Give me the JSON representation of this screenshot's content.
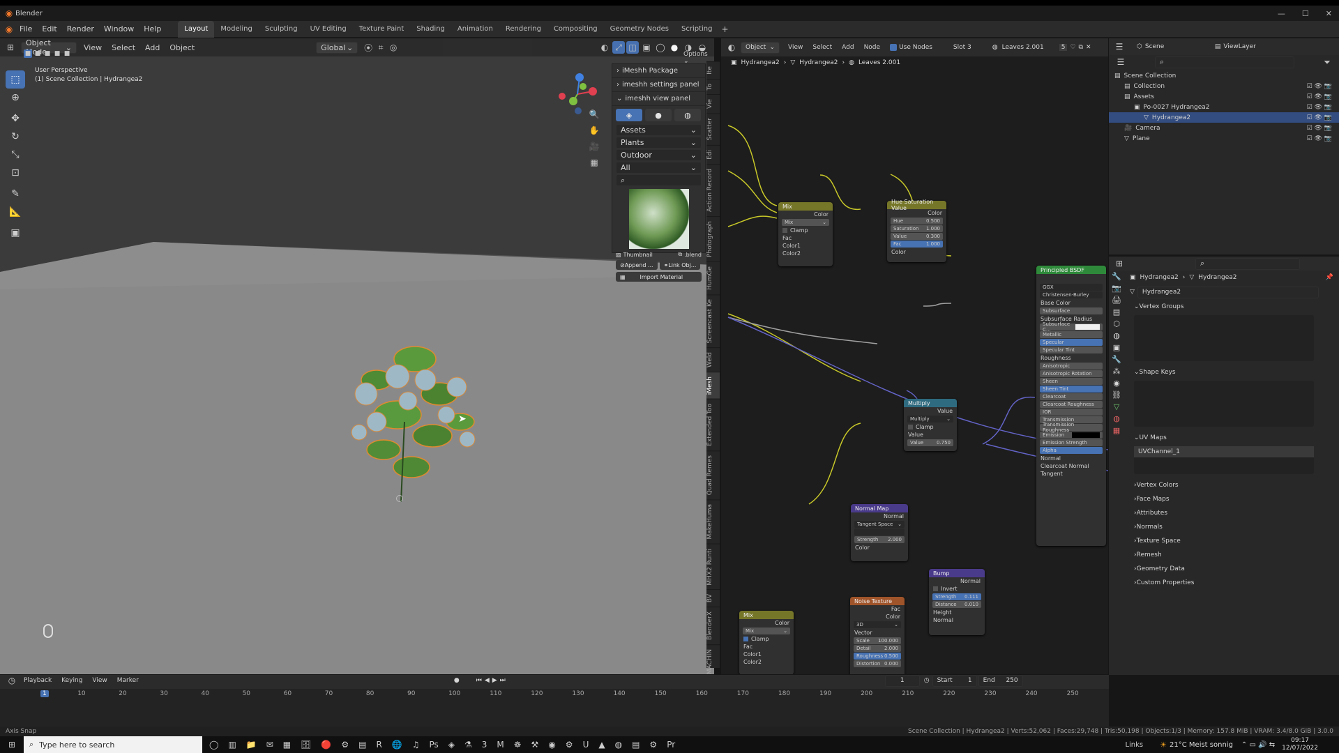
{
  "window": {
    "title": "Blender"
  },
  "menu": [
    "File",
    "Edit",
    "Render",
    "Window",
    "Help"
  ],
  "workspaces": [
    "Layout",
    "Modeling",
    "Sculpting",
    "UV Editing",
    "Texture Paint",
    "Shading",
    "Animation",
    "Rendering",
    "Compositing",
    "Geometry Nodes",
    "Scripting"
  ],
  "viewport": {
    "mode": "Object Mode",
    "menu": [
      "View",
      "Select",
      "Add",
      "Object"
    ],
    "transform": "Global",
    "options": "Options",
    "overlay_title": "User Perspective",
    "overlay_sub": "(1) Scene Collection | Hydrangea2"
  },
  "npanel": {
    "sections": [
      "iMeshh Package",
      "imeshh settings panel",
      "imeshh view panel"
    ],
    "dropdowns": [
      "Assets",
      "Plants",
      "Outdoor",
      "All"
    ],
    "thumbnail": "Thumbnail",
    "blend": ".blend",
    "append": "Append ...",
    "link": "Link Obj...",
    "import": "Import Material"
  },
  "side_tabs": [
    "Ite",
    "To",
    "Vie",
    "Scatter",
    "Edi",
    "Action Record",
    "Photograph",
    "HumGe",
    "Screencast Ke",
    "Weld",
    "iMesh",
    "Extended Too",
    "Quad Remes",
    "MakeHuma",
    "MHX2 Runti",
    "BV",
    "BlenderX",
    "MACHIN"
  ],
  "node_editor": {
    "header": {
      "object": "Object",
      "menu": [
        "View",
        "Select",
        "Add",
        "Node"
      ],
      "use_nodes": "Use Nodes",
      "slot": "Slot 3",
      "material": "Leaves 2.001",
      "users": "5"
    },
    "breadcrumb": [
      "Hydrangea2",
      "Hydrangea2",
      "Leaves 2.001"
    ],
    "nodes": {
      "mix1": {
        "title": "Mix",
        "out": "Color",
        "mode": "Mix",
        "clamp": "Clamp",
        "fac": "Fac",
        "c1": "Color1",
        "c2": "Color2"
      },
      "hue": {
        "title": "Hue Saturation Value",
        "out": "Color",
        "hue": "Hue",
        "hue_v": "0.500",
        "sat": "Saturation",
        "sat_v": "1.000",
        "val": "Value",
        "val_v": "0.300",
        "fac": "Fac",
        "fac_v": "1.000",
        "color": "Color"
      },
      "bsdf": {
        "title": "Principled BSDF",
        "dist": "GGX",
        "sss": "Christensen-Burley",
        "inputs": [
          "Base Color",
          "Subsurface",
          "Subsurface Radius",
          "Subsurface C...",
          "Metallic",
          "Specular",
          "Specular Tint",
          "Roughness",
          "Anisotropic",
          "Anisotropic Rotation",
          "Sheen",
          "Sheen Tint",
          "Clearcoat",
          "Clearcoat Roughness",
          "IOR",
          "Transmission",
          "Transmission Roughness",
          "Emission",
          "Emission Strength",
          "Alpha",
          "Normal",
          "Clearcoat Normal",
          "Tangent"
        ]
      },
      "multiply": {
        "title": "Multiply",
        "out": "Value",
        "mode": "Multiply",
        "clamp": "Clamp",
        "value": "Value",
        "value2": "Value",
        "value2_v": "0.750"
      },
      "normalmap": {
        "title": "Normal Map",
        "out": "Normal",
        "space": "Tangent Space",
        "strength": "Strength",
        "strength_v": "2.000",
        "color": "Color"
      },
      "bump": {
        "title": "Bump",
        "out": "Normal",
        "invert": "Invert",
        "strength": "Strength",
        "strength_v": "0.111",
        "distance": "Distance",
        "distance_v": "0.010",
        "height": "Height",
        "normal": "Normal"
      },
      "noise": {
        "title": "Noise Texture",
        "fac": "Fac",
        "color": "Color",
        "dim": "3D",
        "vector": "Vector",
        "scale": "Scale",
        "scale_v": "100.000",
        "detail": "Detail",
        "detail_v": "2.000",
        "rough": "Roughness",
        "rough_v": "0.500",
        "distortion": "Distortion",
        "distortion_v": "0.000"
      },
      "mix2": {
        "title": "Mix",
        "out": "Color",
        "mode": "Mix",
        "clamp": "Clamp",
        "fac": "Fac",
        "c1": "Color1",
        "c2": "Color2"
      }
    }
  },
  "outliner": {
    "scene": "Scene",
    "view_layer": "ViewLayer",
    "rows": [
      "Scene Collection",
      "Collection",
      "Assets",
      "Po-0027 Hydrangea2",
      "Hydrangea2",
      "Camera",
      "Plane"
    ]
  },
  "properties": {
    "breadcrumb": [
      "Hydrangea2",
      "Hydrangea2"
    ],
    "mesh_name": "Hydrangea2",
    "sections": [
      "Vertex Groups",
      "Shape Keys",
      "UV Maps",
      "Vertex Colors",
      "Face Maps",
      "Attributes",
      "Normals",
      "Texture Space",
      "Remesh",
      "Geometry Data",
      "Custom Properties"
    ],
    "uv_channel": "UVChannel_1"
  },
  "timeline": {
    "menu": [
      "Playback",
      "Keying",
      "View",
      "Marker"
    ],
    "current": "1",
    "start_label": "Start",
    "start": "1",
    "end_label": "End",
    "end": "250",
    "ticks": [
      "1",
      "10",
      "20",
      "30",
      "40",
      "50",
      "60",
      "70",
      "80",
      "90",
      "100",
      "110",
      "120",
      "130",
      "140",
      "150",
      "160",
      "170",
      "180",
      "190",
      "200",
      "210",
      "220",
      "230",
      "240",
      "250"
    ]
  },
  "statusbar": {
    "left": "Axis Snap",
    "right": "Scene Collection | Hydrangea2 | Verts:52,062 | Faces:29,748 | Tris:50,198 | Objects:1/3 | Memory: 157.8 MiB | VRAM: 3.4/8.0 GiB | 3.0.0"
  },
  "taskbar": {
    "search": "Type here to search",
    "links": "Links",
    "weather": "21°C Meist sonnig",
    "time": "09:17",
    "date": "12/07/2022"
  },
  "colors": {
    "accent": "#4772b3",
    "node_yellow": "#c7c729",
    "node_purple": "#6363c7",
    "frame_marker": "#4772b3"
  }
}
